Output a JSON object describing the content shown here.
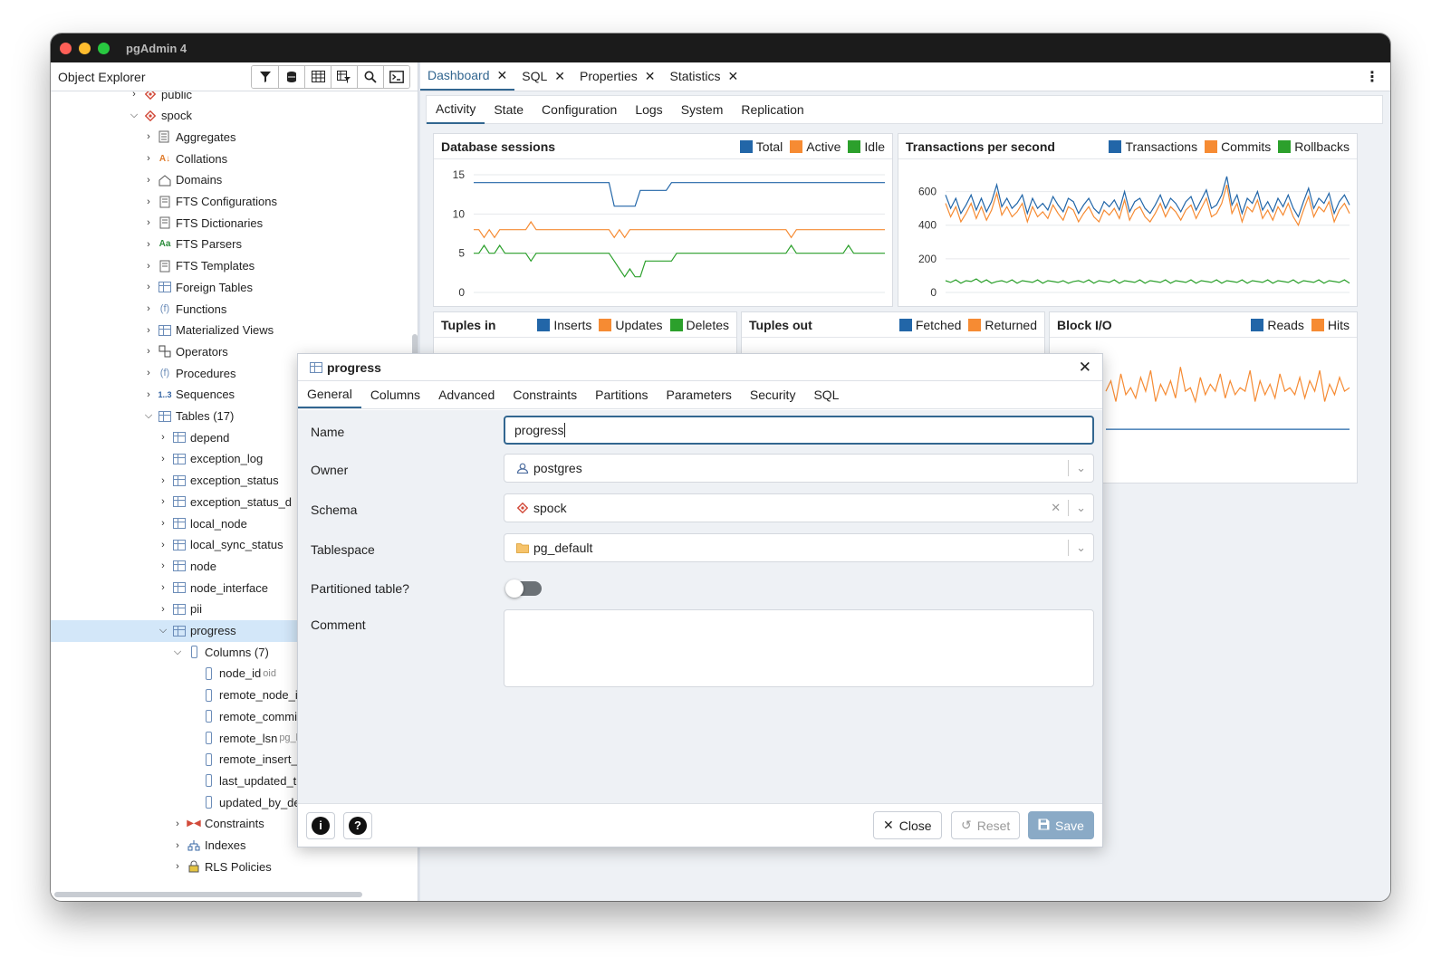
{
  "window": {
    "title": "pgAdmin 4"
  },
  "explorer": {
    "title": "Object Explorer",
    "tools": [
      "filter-icon",
      "database-query-icon",
      "table-view-icon",
      "table-filter-icon",
      "search-icon",
      "terminal-icon"
    ],
    "tree": [
      {
        "label": "public",
        "depth": 0,
        "chev": "›",
        "icon": "db"
      },
      {
        "label": "spock",
        "depth": 0,
        "chev": "⌄",
        "icon": "db"
      },
      {
        "label": "Aggregates",
        "depth": 1,
        "chev": "›",
        "icon": "agg"
      },
      {
        "label": "Collations",
        "depth": 1,
        "chev": "›",
        "icon": "coll"
      },
      {
        "label": "Domains",
        "depth": 1,
        "chev": "›",
        "icon": "dom"
      },
      {
        "label": "FTS Configurations",
        "depth": 1,
        "chev": "›",
        "icon": "fts"
      },
      {
        "label": "FTS Dictionaries",
        "depth": 1,
        "chev": "›",
        "icon": "fts"
      },
      {
        "label": "FTS Parsers",
        "depth": 1,
        "chev": "›",
        "icon": "aa"
      },
      {
        "label": "FTS Templates",
        "depth": 1,
        "chev": "›",
        "icon": "fts"
      },
      {
        "label": "Foreign Tables",
        "depth": 1,
        "chev": "›",
        "icon": "tbl"
      },
      {
        "label": "Functions",
        "depth": 1,
        "chev": "›",
        "icon": "fn"
      },
      {
        "label": "Materialized Views",
        "depth": 1,
        "chev": "›",
        "icon": "tbl"
      },
      {
        "label": "Operators",
        "depth": 1,
        "chev": "›",
        "icon": "op"
      },
      {
        "label": "Procedures",
        "depth": 1,
        "chev": "›",
        "icon": "fn"
      },
      {
        "label": "Sequences",
        "depth": 1,
        "chev": "›",
        "icon": "seq"
      },
      {
        "label": "Tables (17)",
        "depth": 1,
        "chev": "⌄",
        "icon": "tbl"
      },
      {
        "label": "depend",
        "depth": 2,
        "chev": "›",
        "icon": "tbl"
      },
      {
        "label": "exception_log",
        "depth": 2,
        "chev": "›",
        "icon": "tbl"
      },
      {
        "label": "exception_status",
        "depth": 2,
        "chev": "›",
        "icon": "tbl"
      },
      {
        "label": "exception_status_d",
        "depth": 2,
        "chev": "›",
        "icon": "tbl"
      },
      {
        "label": "local_node",
        "depth": 2,
        "chev": "›",
        "icon": "tbl"
      },
      {
        "label": "local_sync_status",
        "depth": 2,
        "chev": "›",
        "icon": "tbl"
      },
      {
        "label": "node",
        "depth": 2,
        "chev": "›",
        "icon": "tbl"
      },
      {
        "label": "node_interface",
        "depth": 2,
        "chev": "›",
        "icon": "tbl"
      },
      {
        "label": "pii",
        "depth": 2,
        "chev": "›",
        "icon": "tbl"
      },
      {
        "label": "progress",
        "depth": 2,
        "chev": "⌄",
        "icon": "tbl",
        "selected": true
      },
      {
        "label": "Columns (7)",
        "depth": 3,
        "chev": "⌄",
        "icon": "col"
      },
      {
        "label": "node_id",
        "depth": 4,
        "chev": "",
        "icon": "col",
        "sub": "oid"
      },
      {
        "label": "remote_node_i",
        "depth": 4,
        "chev": "",
        "icon": "col"
      },
      {
        "label": "remote_commi",
        "depth": 4,
        "chev": "",
        "icon": "col"
      },
      {
        "label": "remote_lsn",
        "depth": 4,
        "chev": "",
        "icon": "col",
        "sub": "pg_l"
      },
      {
        "label": "remote_insert_",
        "depth": 4,
        "chev": "",
        "icon": "col"
      },
      {
        "label": "last_updated_t",
        "depth": 4,
        "chev": "",
        "icon": "col"
      },
      {
        "label": "updated_by_de",
        "depth": 4,
        "chev": "",
        "icon": "col"
      },
      {
        "label": "Constraints",
        "depth": 3,
        "chev": "›",
        "icon": "con"
      },
      {
        "label": "Indexes",
        "depth": 3,
        "chev": "›",
        "icon": "idx"
      },
      {
        "label": "RLS Policies",
        "depth": 3,
        "chev": "›",
        "icon": "rls"
      }
    ]
  },
  "tabs": [
    {
      "label": "Dashboard",
      "active": true
    },
    {
      "label": "SQL"
    },
    {
      "label": "Properties"
    },
    {
      "label": "Statistics"
    }
  ],
  "subtabs": [
    "Activity",
    "State",
    "Configuration",
    "Logs",
    "System",
    "Replication"
  ],
  "colors": {
    "blue": "#2266a8",
    "orange": "#f68b33",
    "green": "#2ca02c",
    "accent": "#326690"
  },
  "panels": {
    "sessions": {
      "title": "Database sessions",
      "legend": [
        "Total",
        "Active",
        "Idle"
      ],
      "yticks": [
        "15",
        "10",
        "5",
        "0"
      ]
    },
    "tps": {
      "title": "Transactions per second",
      "legend": [
        "Transactions",
        "Commits",
        "Rollbacks"
      ],
      "yticks": [
        "600",
        "400",
        "200",
        "0"
      ]
    },
    "tuples_in": {
      "title": "Tuples in",
      "legend": [
        "Inserts",
        "Updates",
        "Deletes"
      ]
    },
    "tuples_out": {
      "title": "Tuples out",
      "legend": [
        "Fetched",
        "Returned"
      ]
    },
    "blockio": {
      "title": "Block I/O",
      "legend": [
        "Reads",
        "Hits"
      ]
    }
  },
  "chart_data": [
    {
      "type": "line",
      "title": "Database sessions",
      "ylim": [
        0,
        15
      ],
      "yticks": [
        0,
        5,
        10,
        15
      ],
      "series": [
        {
          "name": "Total",
          "values": [
            14,
            14,
            14,
            14,
            14,
            14,
            14,
            14,
            14,
            14,
            14,
            14,
            14,
            14,
            14,
            14,
            14,
            14,
            14,
            14,
            14,
            14,
            14,
            14,
            14,
            14,
            14,
            11,
            11,
            11,
            11,
            11,
            13,
            13,
            13,
            13,
            13,
            13,
            14,
            14,
            14,
            14,
            14,
            14,
            14,
            14,
            14,
            14,
            14,
            14,
            14,
            14,
            14,
            14,
            14,
            14,
            14,
            14,
            14,
            14,
            14,
            14,
            14,
            14,
            14,
            14,
            14,
            14,
            14,
            14,
            14,
            14,
            14,
            14,
            14,
            14,
            14,
            14,
            14,
            14
          ]
        },
        {
          "name": "Active",
          "values": [
            8,
            8,
            7,
            8,
            7,
            8,
            8,
            8,
            8,
            8,
            8,
            9,
            8,
            8,
            8,
            8,
            8,
            8,
            8,
            8,
            8,
            8,
            8,
            8,
            8,
            8,
            8,
            7,
            8,
            7,
            8,
            8,
            8,
            8,
            8,
            8,
            8,
            8,
            8,
            8,
            8,
            8,
            8,
            8,
            8,
            8,
            8,
            8,
            8,
            8,
            8,
            8,
            8,
            8,
            8,
            8,
            8,
            8,
            8,
            8,
            8,
            7,
            8,
            8,
            8,
            8,
            8,
            8,
            8,
            8,
            8,
            8,
            8,
            8,
            8,
            8,
            8,
            8,
            8,
            8
          ]
        },
        {
          "name": "Idle",
          "values": [
            5,
            5,
            6,
            5,
            5,
            6,
            5,
            5,
            5,
            5,
            5,
            4,
            5,
            5,
            5,
            5,
            5,
            5,
            5,
            5,
            5,
            5,
            5,
            5,
            5,
            5,
            5,
            4,
            3,
            2,
            3,
            2,
            2,
            4,
            4,
            4,
            4,
            4,
            4,
            5,
            5,
            5,
            5,
            5,
            5,
            5,
            5,
            5,
            5,
            5,
            5,
            5,
            5,
            5,
            5,
            5,
            5,
            5,
            5,
            5,
            5,
            6,
            5,
            5,
            5,
            5,
            5,
            5,
            5,
            5,
            5,
            5,
            6,
            5,
            5,
            5,
            5,
            5,
            5,
            5
          ]
        }
      ]
    },
    {
      "type": "line",
      "title": "Transactions per second",
      "ylim": [
        0,
        700
      ],
      "yticks": [
        0,
        200,
        400,
        600
      ],
      "series": [
        {
          "name": "Transactions",
          "values": [
            580,
            500,
            560,
            470,
            520,
            580,
            490,
            560,
            480,
            540,
            640,
            510,
            560,
            500,
            530,
            580,
            470,
            560,
            500,
            530,
            490,
            570,
            520,
            480,
            560,
            540,
            470,
            520,
            560,
            500,
            470,
            540,
            510,
            550,
            490,
            600,
            480,
            540,
            560,
            500,
            470,
            520,
            580,
            500,
            560,
            530,
            480,
            540,
            570,
            490,
            550,
            610,
            500,
            520,
            580,
            690,
            520,
            580,
            470,
            560,
            530,
            600,
            490,
            540,
            480,
            560,
            510,
            580,
            500,
            450,
            540,
            620,
            500,
            560,
            530,
            590,
            470,
            540,
            580,
            520
          ]
        },
        {
          "name": "Commits",
          "values": [
            530,
            450,
            510,
            420,
            470,
            530,
            440,
            510,
            430,
            490,
            590,
            460,
            510,
            450,
            480,
            530,
            420,
            510,
            450,
            480,
            440,
            520,
            470,
            430,
            510,
            490,
            420,
            470,
            510,
            450,
            420,
            490,
            460,
            500,
            440,
            550,
            430,
            490,
            510,
            450,
            420,
            470,
            530,
            450,
            510,
            480,
            430,
            490,
            520,
            440,
            500,
            560,
            450,
            470,
            530,
            640,
            470,
            530,
            420,
            510,
            480,
            550,
            440,
            490,
            430,
            510,
            460,
            530,
            450,
            400,
            490,
            570,
            450,
            510,
            480,
            540,
            420,
            490,
            530,
            470
          ]
        },
        {
          "name": "Rollbacks",
          "values": [
            70,
            60,
            75,
            55,
            70,
            65,
            80,
            60,
            75,
            55,
            65,
            70,
            60,
            75,
            55,
            70,
            65,
            60,
            75,
            55,
            70,
            65,
            60,
            70,
            55,
            65,
            70,
            60,
            75,
            55,
            70,
            65,
            60,
            75,
            55,
            70,
            65,
            60,
            75,
            55,
            70,
            65,
            60,
            75,
            55,
            70,
            65,
            60,
            75,
            55,
            70,
            65,
            60,
            75,
            55,
            70,
            65,
            60,
            75,
            55,
            70,
            65,
            60,
            75,
            55,
            70,
            65,
            60,
            75,
            55,
            70,
            65,
            60,
            75,
            55,
            70,
            65,
            60,
            75,
            55
          ]
        }
      ]
    },
    {
      "type": "line",
      "title": "Block I/O",
      "series": [
        {
          "name": "Hits",
          "values": [
            55,
            70,
            40,
            80,
            50,
            60,
            45,
            75,
            55,
            85,
            40,
            65,
            50,
            70,
            45,
            90,
            55,
            60,
            40,
            75,
            50,
            65,
            55,
            80,
            45,
            70,
            50,
            60,
            55,
            85,
            40,
            70,
            50,
            65,
            45,
            80,
            55,
            60,
            50,
            75,
            45,
            70,
            55,
            85,
            40,
            65,
            50,
            75,
            55,
            60
          ]
        },
        {
          "name": "Reads",
          "values": [
            0,
            0,
            0,
            0,
            0,
            0,
            0,
            0,
            0,
            0,
            0,
            0,
            0,
            0,
            0,
            0,
            0,
            0,
            0,
            0,
            0,
            0,
            0,
            0,
            0,
            0,
            0,
            0,
            0,
            0,
            0,
            0,
            0,
            0,
            0,
            0,
            0,
            0,
            0,
            0,
            0,
            0,
            0,
            0,
            0,
            0,
            0,
            0,
            0,
            0
          ]
        }
      ]
    }
  ],
  "dialog": {
    "title": "progress",
    "tabs": [
      "General",
      "Columns",
      "Advanced",
      "Constraints",
      "Partitions",
      "Parameters",
      "Security",
      "SQL"
    ],
    "fields": {
      "name_label": "Name",
      "name_value": "progress",
      "owner_label": "Owner",
      "owner_value": "postgres",
      "schema_label": "Schema",
      "schema_value": "spock",
      "tablespace_label": "Tablespace",
      "tablespace_value": "pg_default",
      "partitioned_label": "Partitioned table?",
      "partitioned_value": false,
      "comment_label": "Comment",
      "comment_value": ""
    },
    "buttons": {
      "close": "Close",
      "reset": "Reset",
      "save": "Save"
    }
  }
}
